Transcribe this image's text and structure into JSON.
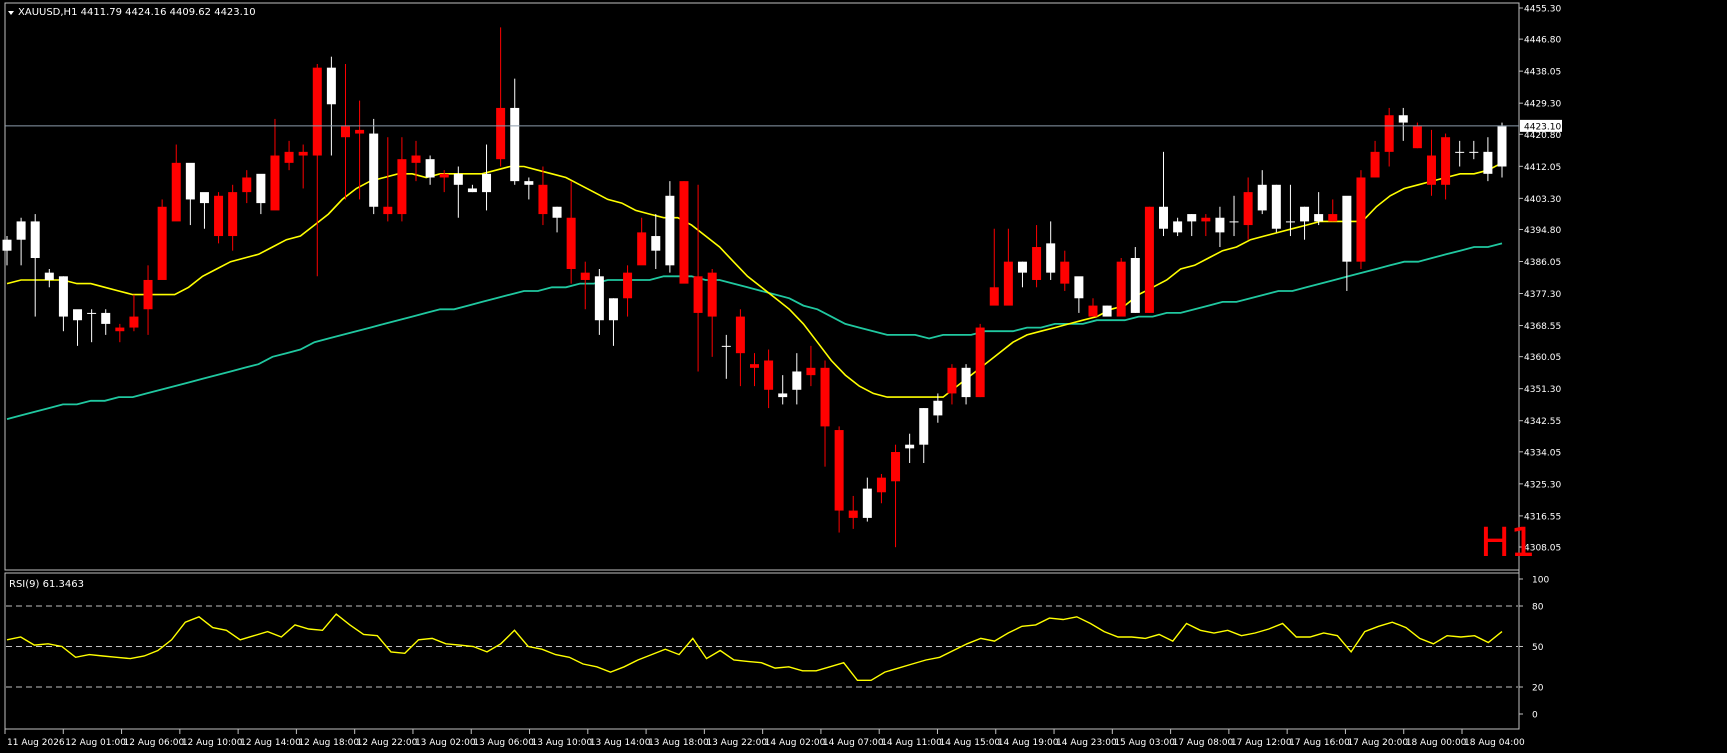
{
  "symbol_header": "XAUUSD,H1  4411.79 4424.16 4409.62 4423.10",
  "timeframe_label": "H1",
  "rsi_header": "RSI(9) 61.3463",
  "price_scale": [
    "4455.30",
    "4446.80",
    "4438.05",
    "4429.30",
    "4420.80",
    "4412.05",
    "4403.30",
    "4394.80",
    "4386.05",
    "4377.30",
    "4368.55",
    "4360.05",
    "4351.30",
    "4342.55",
    "4334.05",
    "4325.30",
    "4316.55",
    "4308.05"
  ],
  "current_price_tag": "4423.10",
  "rsi_scale": [
    "100",
    "80",
    "50",
    "20",
    "0"
  ],
  "time_labels": [
    "11 Aug 2026",
    "12 Aug 01:00",
    "12 Aug 06:00",
    "12 Aug 10:00",
    "12 Aug 14:00",
    "12 Aug 18:00",
    "12 Aug 22:00",
    "13 Aug 02:00",
    "13 Aug 06:00",
    "13 Aug 10:00",
    "13 Aug 14:00",
    "13 Aug 18:00",
    "13 Aug 22:00",
    "14 Aug 02:00",
    "14 Aug 07:00",
    "14 Aug 11:00",
    "14 Aug 15:00",
    "14 Aug 19:00",
    "14 Aug 23:00",
    "15 Aug 03:00",
    "17 Aug 08:00",
    "17 Aug 12:00",
    "17 Aug 16:00",
    "17 Aug 20:00",
    "18 Aug 00:00",
    "18 Aug 04:00"
  ],
  "colors": {
    "background": "#000000",
    "bull": "#FFFFFF",
    "bear": "#FF0000",
    "ma_fast": "#FFFF00",
    "ma_slow": "#20C8A0",
    "rsi": "#FFFF00",
    "grid_text": "#FFFFFF",
    "timeframe_text": "#FF0000"
  },
  "chart_data": {
    "type": "candlestick",
    "symbol": "XAUUSD",
    "timeframe": "H1",
    "ohlc_last": {
      "open": 4411.79,
      "high": 4424.16,
      "low": 4409.62,
      "close": 4423.1
    },
    "ylim": [
      4308.05,
      4455.3
    ],
    "candles": [
      [
        4389,
        4393,
        4385,
        4392
      ],
      [
        4392,
        4398,
        4385,
        4397
      ],
      [
        4387,
        4399,
        4371,
        4397
      ],
      [
        4381,
        4384,
        4379,
        4383
      ],
      [
        4371,
        4382,
        4367,
        4382
      ],
      [
        4370,
        4372,
        4363,
        4373
      ],
      [
        4372,
        4373,
        4364,
        4372
      ],
      [
        4369,
        4373,
        4366,
        4372
      ],
      [
        4368,
        4369,
        4364,
        4367
      ],
      [
        4371,
        4377,
        4367,
        4368
      ],
      [
        4381,
        4385,
        4366,
        4373
      ],
      [
        4401,
        4403,
        4383,
        4381
      ],
      [
        4413,
        4418,
        4398,
        4397
      ],
      [
        4403,
        4412,
        4396,
        4413
      ],
      [
        4402,
        4403,
        4395,
        4405
      ],
      [
        4404,
        4405,
        4391,
        4393
      ],
      [
        4405,
        4407,
        4389,
        4393
      ],
      [
        4409,
        4411,
        4402,
        4405
      ],
      [
        4402,
        4409,
        4399,
        4410
      ],
      [
        4415,
        4425,
        4401,
        4400
      ],
      [
        4416,
        4419,
        4411,
        4413
      ],
      [
        4416,
        4418,
        4406,
        4415
      ],
      [
        4439,
        4440,
        4382,
        4415
      ],
      [
        4429,
        4442,
        4415,
        4439
      ],
      [
        4423,
        4440,
        4403,
        4420
      ],
      [
        4422,
        4430,
        4403,
        4421
      ],
      [
        4401,
        4425,
        4399,
        4421
      ],
      [
        4401,
        4420,
        4397,
        4399
      ],
      [
        4414,
        4420,
        4397,
        4399
      ],
      [
        4415,
        4419,
        4408,
        4413
      ],
      [
        4409,
        4415,
        4407,
        4414
      ],
      [
        4410,
        4411,
        4405,
        4409
      ],
      [
        4407,
        4412,
        4398,
        4410
      ],
      [
        4405,
        4407,
        4405,
        4406
      ],
      [
        4405,
        4418,
        4400,
        4410
      ],
      [
        4428,
        4450,
        4412,
        4414
      ],
      [
        4408,
        4436,
        4407,
        4428
      ],
      [
        4407,
        4409,
        4403,
        4408
      ],
      [
        4407,
        4412,
        4396,
        4399
      ],
      [
        4398,
        4401,
        4394,
        4401
      ],
      [
        4398,
        4408,
        4380,
        4384
      ],
      [
        4383,
        4386,
        4373,
        4381
      ],
      [
        4370,
        4384,
        4366,
        4382
      ],
      [
        4370,
        4376,
        4363,
        4376
      ],
      [
        4383,
        4385,
        4371,
        4376
      ],
      [
        4394,
        4398,
        4386,
        4385
      ],
      [
        4389,
        4399,
        4384,
        4393
      ],
      [
        4385,
        4408,
        4383,
        4404
      ],
      [
        4408,
        4408,
        4388,
        4380
      ],
      [
        4382,
        4407,
        4356,
        4372
      ],
      [
        4383,
        4384,
        4360,
        4371
      ],
      [
        4363,
        4366,
        4354,
        4363
      ],
      [
        4371,
        4373,
        4352,
        4361
      ],
      [
        4358,
        4361,
        4352,
        4357
      ],
      [
        4359,
        4362,
        4346,
        4351
      ],
      [
        4349,
        4355,
        4347,
        4350
      ],
      [
        4351,
        4361,
        4347,
        4356
      ],
      [
        4357,
        4363,
        4352,
        4355
      ],
      [
        4357,
        4359,
        4330,
        4341
      ],
      [
        4340,
        4341,
        4312,
        4318
      ],
      [
        4318,
        4322,
        4313,
        4316
      ],
      [
        4316,
        4327,
        4315,
        4324
      ],
      [
        4327,
        4328,
        4320,
        4323
      ],
      [
        4334,
        4336,
        4308,
        4326
      ],
      [
        4335,
        4339,
        4331,
        4336
      ],
      [
        4336,
        4346,
        4331,
        4346
      ],
      [
        4344,
        4350,
        4342,
        4348
      ],
      [
        4357,
        4358,
        4347,
        4350
      ],
      [
        4349,
        4358,
        4347,
        4357
      ],
      [
        4368,
        4369,
        4349,
        4349
      ],
      [
        4379,
        4395,
        4376,
        4374
      ],
      [
        4386,
        4395,
        4377,
        4374
      ],
      [
        4383,
        4386,
        4379,
        4386
      ],
      [
        4390,
        4396,
        4379,
        4381
      ],
      [
        4383,
        4397,
        4381,
        4391
      ],
      [
        4386,
        4389,
        4378,
        4380
      ],
      [
        4376,
        4380,
        4372,
        4382
      ],
      [
        4374,
        4376,
        4371,
        4371
      ],
      [
        4371,
        4374,
        4372,
        4374
      ],
      [
        4386,
        4387,
        4372,
        4371
      ],
      [
        4372,
        4390,
        4372,
        4387
      ],
      [
        4401,
        4401,
        4372,
        4372
      ],
      [
        4395,
        4416,
        4393,
        4401
      ],
      [
        4394,
        4398,
        4393,
        4397
      ],
      [
        4397,
        4399,
        4393,
        4399
      ],
      [
        4398,
        4399,
        4393,
        4397
      ],
      [
        4394,
        4401,
        4390,
        4398
      ],
      [
        4397,
        4404,
        4393,
        4397
      ],
      [
        4405,
        4409,
        4392,
        4396
      ],
      [
        4400,
        4411,
        4399,
        4407
      ],
      [
        4395,
        4407,
        4394,
        4407
      ],
      [
        4397,
        4407,
        4393,
        4397
      ],
      [
        4397,
        4401,
        4392,
        4401
      ],
      [
        4397,
        4405,
        4396,
        4399
      ],
      [
        4399,
        4403,
        4397,
        4397
      ],
      [
        4386,
        4398,
        4378,
        4404
      ],
      [
        4409,
        4411,
        4384,
        4386
      ],
      [
        4416,
        4419,
        4409,
        4409
      ],
      [
        4426,
        4428,
        4412,
        4416
      ],
      [
        4424,
        4428,
        4419,
        4426
      ],
      [
        4423,
        4424,
        4417,
        4417
      ],
      [
        4415,
        4422,
        4404,
        4407
      ],
      [
        4420,
        4421,
        4403,
        4407
      ],
      [
        4416,
        4419,
        4412,
        4416
      ],
      [
        4416,
        4419,
        4414,
        4416
      ],
      [
        4410,
        4420,
        4408,
        4416
      ],
      [
        4412,
        4424,
        4409,
        4423
      ]
    ],
    "ma_fast": [
      4380,
      4381,
      4381,
      4381,
      4381,
      4380,
      4380,
      4379,
      4378,
      4377,
      4377,
      4377,
      4377,
      4379,
      4382,
      4384,
      4386,
      4387,
      4388,
      4390,
      4392,
      4393,
      4396,
      4399,
      4403,
      4406,
      4408,
      4409,
      4410,
      4410,
      4409,
      4410,
      4410,
      4410,
      4410,
      4411,
      4412,
      4412,
      4411,
      4410,
      4409,
      4407,
      4405,
      4403,
      4402,
      4400,
      4399,
      4398,
      4398,
      4396,
      4393,
      4390,
      4386,
      4382,
      4379,
      4376,
      4373,
      4369,
      4364,
      4359,
      4355,
      4352,
      4350,
      4349,
      4349,
      4349,
      4349,
      4349,
      4352,
      4355,
      4358,
      4361,
      4364,
      4366,
      4367,
      4368,
      4369,
      4370,
      4371,
      4373,
      4374,
      4377,
      4379,
      4381,
      4384,
      4385,
      4387,
      4389,
      4390,
      4392,
      4393,
      4394,
      4395,
      4396,
      4397,
      4397,
      4397,
      4397,
      4401,
      4404,
      4406,
      4407,
      4408,
      4409,
      4410,
      4410,
      4411,
      4413
    ],
    "ma_slow": [
      4343,
      4344,
      4345,
      4346,
      4347,
      4347,
      4348,
      4348,
      4349,
      4349,
      4350,
      4351,
      4352,
      4353,
      4354,
      4355,
      4356,
      4357,
      4358,
      4360,
      4361,
      4362,
      4364,
      4365,
      4366,
      4367,
      4368,
      4369,
      4370,
      4371,
      4372,
      4373,
      4373,
      4374,
      4375,
      4376,
      4377,
      4378,
      4378,
      4379,
      4379,
      4380,
      4380,
      4381,
      4381,
      4381,
      4381,
      4382,
      4382,
      4382,
      4381,
      4381,
      4380,
      4379,
      4378,
      4377,
      4376,
      4374,
      4373,
      4371,
      4369,
      4368,
      4367,
      4366,
      4366,
      4366,
      4365,
      4366,
      4366,
      4366,
      4367,
      4367,
      4367,
      4368,
      4368,
      4369,
      4369,
      4369,
      4370,
      4370,
      4370,
      4371,
      4371,
      4372,
      4372,
      4373,
      4374,
      4375,
      4375,
      4376,
      4377,
      4378,
      4378,
      4379,
      4380,
      4381,
      4382,
      4383,
      4384,
      4385,
      4386,
      4386,
      4387,
      4388,
      4389,
      4390,
      4390,
      4391
    ],
    "rsi": [
      55,
      57,
      51,
      52,
      50,
      42,
      44,
      43,
      42,
      41,
      43,
      47,
      55,
      68,
      72,
      64,
      62,
      55,
      58,
      61,
      57,
      66,
      63,
      62,
      74,
      66,
      59,
      58,
      46,
      45,
      55,
      56,
      52,
      51,
      50,
      46,
      52,
      62,
      50,
      48,
      44,
      42,
      37,
      35,
      31,
      35,
      40,
      44,
      48,
      44,
      56,
      41,
      47,
      40,
      39,
      38,
      34,
      35,
      32,
      32,
      35,
      38,
      25,
      25,
      31,
      34,
      37,
      40,
      42,
      47,
      52,
      56,
      54,
      60,
      65,
      66,
      71,
      70,
      72,
      67,
      61,
      57,
      57,
      56,
      59,
      54,
      67,
      62,
      60,
      62,
      58,
      60,
      63,
      67,
      57,
      57,
      60,
      58,
      46,
      61,
      65,
      68,
      64,
      56,
      52,
      58,
      57,
      58,
      53,
      61
    ],
    "rsi_levels": [
      80,
      50,
      20
    ],
    "rsi_ylim": [
      0,
      100
    ],
    "series": [
      {
        "name": "XAUUSD,H1"
      },
      {
        "name": "RSI(9) 61.3463"
      }
    ]
  }
}
